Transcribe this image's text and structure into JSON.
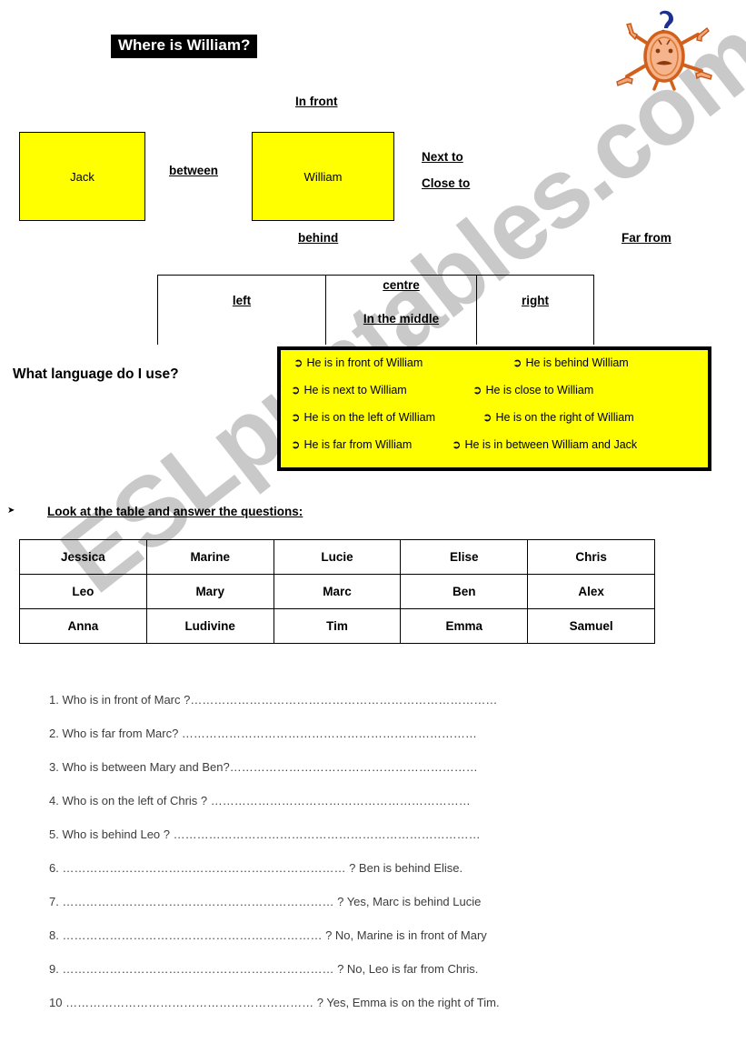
{
  "title": "Where is William?",
  "mascot": {
    "icon": "confused-person-pointing-icon"
  },
  "diagram": {
    "box_jack": "Jack",
    "box_william": "William",
    "label_in_front": "In front",
    "label_behind": "behind",
    "label_between": "between",
    "label_next_to": "Next to",
    "label_close_to": "Close to",
    "label_far_from": "Far from"
  },
  "position_table": {
    "left": "left",
    "centre": "centre",
    "in_the_middle": "In the middle",
    "right": "right"
  },
  "what_language": "What language do I use?",
  "panel": {
    "bullet": "➲",
    "rows": [
      {
        "left": "He is in front of William",
        "right": "He is behind William"
      },
      {
        "left": "He is next to William",
        "right": "He is close to William"
      },
      {
        "left": "He is on the left of William",
        "right": "He is on the right of William"
      },
      {
        "left": "He is far from William",
        "right": "He is in between William and Jack"
      }
    ]
  },
  "instruction": {
    "arrow": "➤",
    "text": "Look at the table and answer the questions:"
  },
  "names_table": {
    "rows": [
      [
        "Jessica",
        "Marine",
        "Lucie",
        "Elise",
        "Chris"
      ],
      [
        "Leo",
        "Mary",
        "Marc",
        "Ben",
        "Alex"
      ],
      [
        "Anna",
        "Ludivine",
        "Tim",
        "Emma",
        "Samuel"
      ]
    ]
  },
  "questions": [
    {
      "num": "1.",
      "text": "Who is in front of Marc ?……………………………………………………………………"
    },
    {
      "num": "2.",
      "text": "Who is far from Marc? …………………………………………………………………"
    },
    {
      "num": "3.",
      "text": "Who is between Mary and Ben?………………………………………………………"
    },
    {
      "num": "4.",
      "text": "Who is on the left of Chris ? …………………………………………………………"
    },
    {
      "num": "5.",
      "text": "Who is behind Leo ? ……………………………………………………………………"
    },
    {
      "num": "6.",
      "text": "……………………………………………………………… ? Ben is behind Elise."
    },
    {
      "num": "7.",
      "text": "…………………………………………………………… ? Yes, Marc is behind Lucie"
    },
    {
      "num": "8.",
      "text": "………………………………………………………… ? No, Marine is in front of Mary"
    },
    {
      "num": "9.",
      "text": "…………………………………………………………… ? No, Leo is far from Chris."
    },
    {
      "num": "10",
      "text": "……………………………………………………… ? Yes, Emma is on the right of Tim."
    }
  ],
  "watermark": "ESLprintables.com",
  "colors": {
    "highlight_yellow": "#ffff00",
    "title_bg": "#000000",
    "watermark_gray": "#c9c9c9"
  }
}
